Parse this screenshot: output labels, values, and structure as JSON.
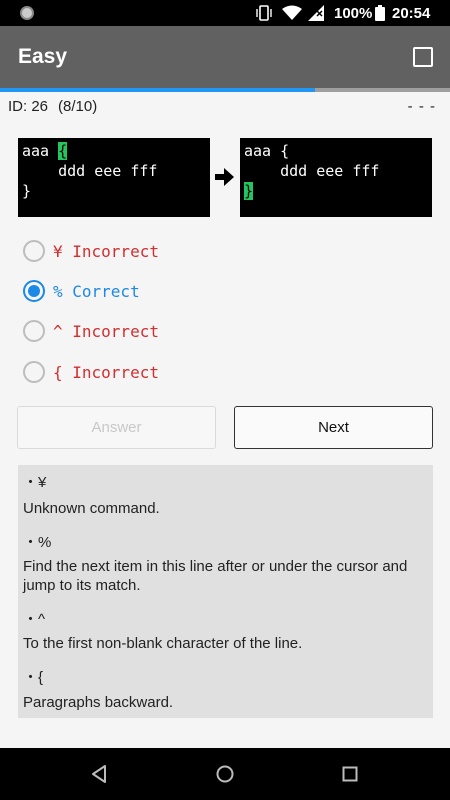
{
  "status_bar": {
    "battery_percent": "100%",
    "time": "20:54",
    "icons": [
      "vibrate-icon",
      "wifi-icon",
      "signal-icon",
      "battery-icon"
    ]
  },
  "app_bar": {
    "title": "Easy",
    "progress_fraction": 0.7
  },
  "question": {
    "id_label": "ID: 26",
    "counter": "(8/10)",
    "status": "- - -"
  },
  "code_before": {
    "line1_prefix": "aaa ",
    "line1_cursor": "{",
    "line2": "    ddd eee fff",
    "line3": "}"
  },
  "code_after": {
    "line1": "aaa {",
    "line2": "    ddd eee fff",
    "line3_cursor": "}"
  },
  "choices": [
    {
      "text": "¥ Incorrect",
      "state": "incorrect",
      "selected": false
    },
    {
      "text": "% Correct",
      "state": "correct",
      "selected": true
    },
    {
      "text": "^ Incorrect",
      "state": "incorrect",
      "selected": false
    },
    {
      "text": "{ Incorrect",
      "state": "incorrect",
      "selected": false
    }
  ],
  "buttons": {
    "answer": "Answer",
    "next": "Next"
  },
  "explanations": [
    {
      "key": "・¥",
      "text": "Unknown command."
    },
    {
      "key": "・%",
      "text": "Find the next item in this line after or under the cursor and jump to its match."
    },
    {
      "key": "・^",
      "text": "To the first non-blank character of the line."
    },
    {
      "key": "・{",
      "text": "Paragraphs backward."
    }
  ],
  "colors": {
    "accent": "#2196f3",
    "incorrect": "#d32f2f",
    "correct": "#1e88e5",
    "cursor_highlight": "#22c55e"
  }
}
